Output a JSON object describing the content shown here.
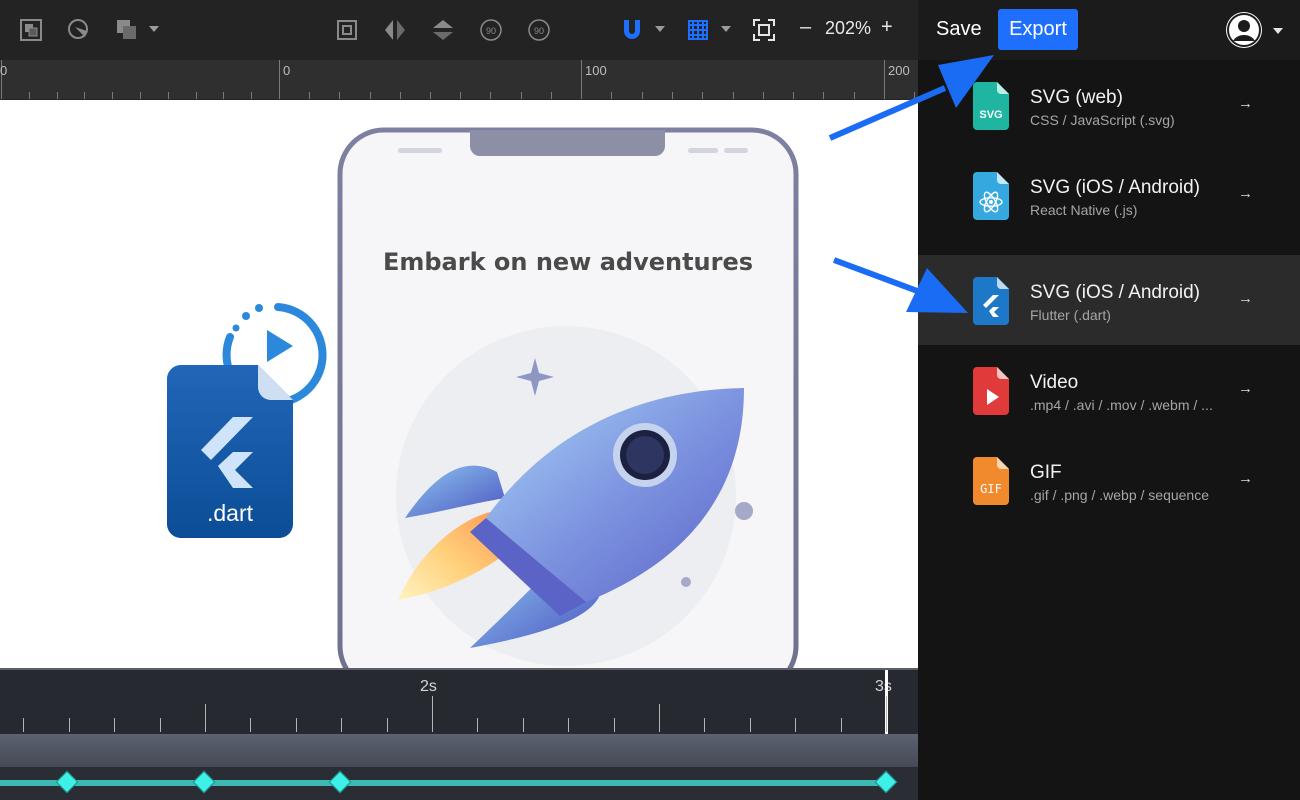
{
  "toolbar": {
    "icons": [
      "group-icon",
      "mask-icon",
      "boolean-icon",
      "align-frame-icon",
      "flip-horizontal-icon",
      "flip-vertical-icon",
      "rotate-left-90-icon",
      "rotate-right-90-icon",
      "snap-magnet-icon",
      "grid-icon",
      "fit-screen-icon"
    ],
    "rotate_left_label": "90",
    "rotate_right_label": "90",
    "zoom_minus": "–",
    "zoom_value": "202%",
    "zoom_plus": "+",
    "accent_color": "#1f6fff"
  },
  "ruler": {
    "labels": [
      "0",
      "0",
      "100",
      "200"
    ]
  },
  "canvas": {
    "headline": "Embark on new adventures",
    "file_badge_label": ".dart"
  },
  "timeline": {
    "labels": [
      "2s",
      "3s"
    ],
    "keyframe_color": "#3ff0e6"
  },
  "header": {
    "save_label": "Save",
    "export_label": "Export"
  },
  "export_menu": {
    "items": [
      {
        "title": "SVG (web)",
        "subtitle": "CSS / JavaScript (.svg)",
        "icon": "svg-file-icon",
        "color": "#1fb5a0"
      },
      {
        "title": "SVG (iOS / Android)",
        "subtitle": "React Native (.js)",
        "icon": "react-file-icon",
        "color": "#36a8e0"
      },
      {
        "title": "SVG (iOS / Android)",
        "subtitle": "Flutter (.dart)",
        "icon": "flutter-file-icon",
        "color": "#1e78c8"
      },
      {
        "title": "Video",
        "subtitle": ".mp4 / .avi / .mov / .webm / ...",
        "icon": "video-file-icon",
        "color": "#e03a3a"
      },
      {
        "title": "GIF",
        "subtitle": ".gif / .png / .webp / sequence",
        "icon": "gif-file-icon",
        "color": "#f08a2c"
      }
    ],
    "arrow": "→"
  }
}
